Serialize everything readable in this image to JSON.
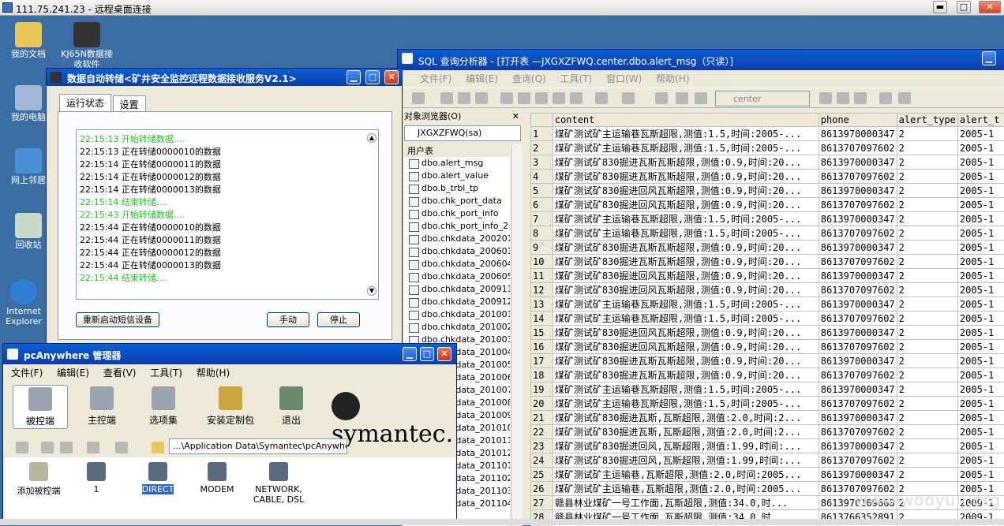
{
  "rdp": {
    "title": "111.75.241.23 - 远程桌面连接",
    "min": "▬",
    "max": "□",
    "close": "✕"
  },
  "desktop_icons": [
    {
      "name": "我的文档"
    },
    {
      "name": "KJ65N数据接收软件"
    },
    {
      "name": "我的电脑"
    },
    {
      "name": "网上邻居"
    },
    {
      "name": "回收站"
    },
    {
      "name": "Internet Explorer"
    }
  ],
  "xfer": {
    "title": "数据自动转储<矿井安全监控远程数据接收服务V2.1>",
    "tabs": [
      "运行状态",
      "设置"
    ],
    "log": [
      {
        "text": "22:15:13 开始转储数据....",
        "green": true
      },
      {
        "text": "22:15:13 正在转储0000010的数据",
        "green": false
      },
      {
        "text": "22:15:14 正在转储0000011的数据",
        "green": false
      },
      {
        "text": "22:15:14 正在转储0000012的数据",
        "green": false
      },
      {
        "text": "22:15:14 正在转储0000013的数据",
        "green": false
      },
      {
        "text": "22:15:14 结束转储....",
        "green": true
      },
      {
        "text": "22:15:43 开始转储数据....",
        "green": true
      },
      {
        "text": "22:15:44 正在转储0000010的数据",
        "green": false
      },
      {
        "text": "22:15:44 正在转储0000011的数据",
        "green": false
      },
      {
        "text": "22:15:44 正在转储0000012的数据",
        "green": false
      },
      {
        "text": "22:15:44 正在转储0000013的数据",
        "green": false
      },
      {
        "text": "22:15:44 结束转储....",
        "green": true
      }
    ],
    "btn_restart": "重新启动短信设备",
    "btn_manual": "手动",
    "btn_stop": "停止"
  },
  "sql": {
    "title": "SQL 查询分析器 - [打开表 —JXGXZFWQ.center.dbo.alert_msg（只读）]",
    "menus": [
      "文件(F)",
      "编辑(E)",
      "查询(Q)",
      "工具(T)",
      "窗口(W)",
      "帮助(H)"
    ],
    "db_selected": "center",
    "obj_browser_label": "对象浏览器(O)",
    "obj_close": "✕",
    "server": "JXGXZFWQ(sa)",
    "group": "用户表",
    "tables": [
      "dbo.alert_msg",
      "dbo.alert_value",
      "dbo.b_trbl_tp",
      "dbo.chk_port_data",
      "dbo.chk_port_info",
      "dbo.chk_port_info_2",
      "dbo.chkdata_200201",
      "dbo.chkdata_200601",
      "dbo.chkdata_200604",
      "dbo.chkdata_200605",
      "dbo.chkdata_200911",
      "dbo.chkdata_200912",
      "dbo.chkdata_201001",
      "dbo.chkdata_201002",
      "dbo.chkdata_201003",
      "dbo.chkdata_201004",
      "dbo.chkdata_201005",
      "dbo.chkdata_201006",
      "dbo.chkdata_201007",
      "dbo.chkdata_201008",
      "dbo.chkdata_201009",
      "dbo.chkdata_201010",
      "dbo.chkdata_201011",
      "dbo.chkdata_201012",
      "dbo.chkdata_201101",
      "dbo.chkdata_201102",
      "dbo.chkdata_201103",
      "dbo.chkdata_201104"
    ],
    "columns": [
      "content",
      "phone",
      "alert_type",
      "alert_t"
    ],
    "rows": [
      [
        "1",
        "煤矿测试矿主运输巷瓦斯超限,测值:1.5,时间:2005-...",
        "8613970000347",
        "2",
        "2005-1"
      ],
      [
        "2",
        "煤矿测试矿主运输巷瓦斯超限,测值:1.5,时间:2005-...",
        "8613707097602",
        "2",
        "2005-1"
      ],
      [
        "3",
        "煤矿测试矿830掘进瓦斯瓦斯超限,测值:0.9,时间:20...",
        "8613970000347",
        "2",
        "2005-1"
      ],
      [
        "4",
        "煤矿测试矿830掘进瓦斯瓦斯超限,测值:0.9,时间:20...",
        "8613707097602",
        "2",
        "2005-1"
      ],
      [
        "5",
        "煤矿测试矿830掘进回风瓦斯超限,测值:0.9,时间:20...",
        "8613970000347",
        "2",
        "2005-1"
      ],
      [
        "6",
        "煤矿测试矿830掘进回风瓦斯超限,测值:0.9,时间:20...",
        "8613707097602",
        "2",
        "2005-1"
      ],
      [
        "7",
        "煤矿测试矿主运输巷瓦斯超限,测值:1.5,时间:2005-...",
        "8613970000347",
        "2",
        "2005-1"
      ],
      [
        "8",
        "煤矿测试矿主运输巷瓦斯超限,测值:1.5,时间:2005-...",
        "8613707097602",
        "2",
        "2005-1"
      ],
      [
        "9",
        "煤矿测试矿830掘进瓦斯瓦斯超限,测值:0.9,时间:20...",
        "8613970000347",
        "2",
        "2005-1"
      ],
      [
        "10",
        "煤矿测试矿830掘进瓦斯瓦斯超限,测值:0.9,时间:20...",
        "8613707097602",
        "2",
        "2005-1"
      ],
      [
        "11",
        "煤矿测试矿830掘进回风瓦斯超限,测值:0.9,时间:20...",
        "8613970000347",
        "2",
        "2005-1"
      ],
      [
        "12",
        "煤矿测试矿830掘进回风瓦斯超限,测值:0.9,时间:20...",
        "8613707097602",
        "2",
        "2005-1"
      ],
      [
        "13",
        "煤矿测试矿主运输巷瓦斯超限,测值:1.5,时间:2005-...",
        "8613970000347",
        "2",
        "2005-1"
      ],
      [
        "14",
        "煤矿测试矿主运输巷瓦斯超限,测值:1.5,时间:2005-...",
        "8613707097602",
        "2",
        "2005-1"
      ],
      [
        "15",
        "煤矿测试矿830掘进回风瓦斯超限,测值:0.9,时间:20...",
        "8613970000347",
        "2",
        "2005-1"
      ],
      [
        "16",
        "煤矿测试矿830掘进回风瓦斯超限,测值:0.9,时间:20...",
        "8613707097602",
        "2",
        "2005-1"
      ],
      [
        "17",
        "煤矿测试矿830掘进瓦斯瓦斯超限,测值:0.9,时间:20...",
        "8613970000347",
        "2",
        "2005-1"
      ],
      [
        "18",
        "煤矿测试矿830掘进瓦斯瓦斯超限,测值:0.9,时间:20...",
        "8613707097602",
        "2",
        "2005-1"
      ],
      [
        "19",
        "煤矿测试矿主运输巷瓦斯超限,测值:1.5,时间:2005-...",
        "8613970000347",
        "2",
        "2005-1"
      ],
      [
        "20",
        "煤矿测试矿主运输巷瓦斯超限,测值:1.5,时间:2005-...",
        "8613707097602",
        "2",
        "2005-1"
      ],
      [
        "21",
        "煤矿测试矿830掘进瓦斯,瓦斯超限,测值:2.0,时间:2...",
        "8613970000347",
        "2",
        "2005-1"
      ],
      [
        "22",
        "煤矿测试矿830掘进瓦斯,瓦斯超限,测值:2.0,时间:2...",
        "8613707097602",
        "2",
        "2005-1"
      ],
      [
        "23",
        "煤矿测试矿830掘进回风,瓦斯超限,测值:1.99,时间:...",
        "8613970000347",
        "2",
        "2005-1"
      ],
      [
        "24",
        "煤矿测试矿830掘进回风,瓦斯超限,测值:1.99,时间:...",
        "8613707097602",
        "2",
        "2005-1"
      ],
      [
        "25",
        "煤矿测试矿主运输巷,瓦斯超限,测值:2.0,时间:2005...",
        "8613970000347",
        "2",
        "2005-1"
      ],
      [
        "26",
        "煤矿测试矿主运输巷,瓦斯超限,测值:2.0,时间:2005...",
        "8613707097602",
        "2",
        "2005-1"
      ],
      [
        "27",
        "赣县林业煤矿一号工作面,瓦斯超限,测值:34.0,时...",
        "8613970109668",
        "2",
        "2009-1"
      ],
      [
        "28",
        "赣县林业煤矿一号工作面,瓦斯超限,测值:34.0,时...",
        "8613766352891",
        "2",
        "2009-1"
      ],
      [
        "29",
        "赣县林业煤矿一号工作面,瓦斯超限,测值:34.0,时...",
        "8613979715669",
        "2",
        "2009-1"
      ]
    ]
  },
  "pca": {
    "title": "pcAnywhere 管理器",
    "menus": [
      "文件(F)",
      "编辑(E)",
      "查看(V)",
      "工具(T)",
      "帮助(H)"
    ],
    "buttons": [
      "被控端",
      "主控端",
      "选项集",
      "安装定制包",
      "退出"
    ],
    "logo": "symantec.",
    "path": "...\\Application Data\\Symantec\\pcAnywhere",
    "hosts": [
      "添加被控端",
      "1",
      "DIRECT",
      "MODEM",
      "NETWORK, CABLE, DSL"
    ]
  },
  "watermark": "www.wooyun.org"
}
